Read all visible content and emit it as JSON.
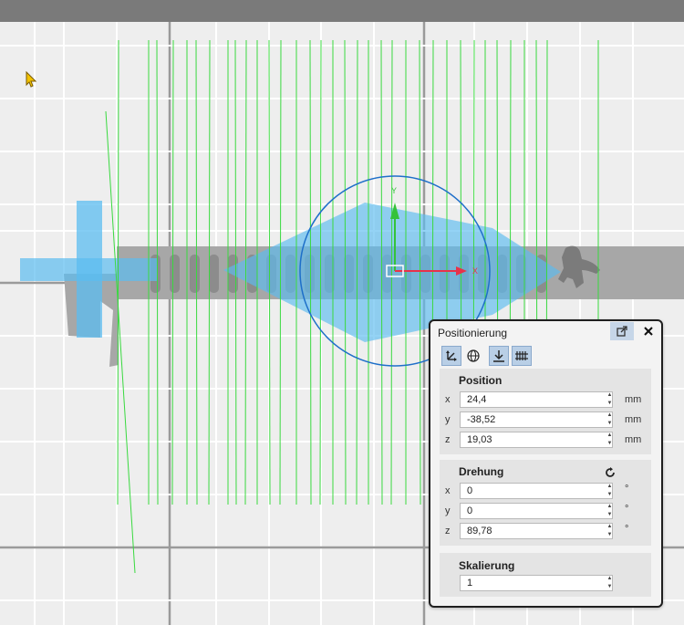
{
  "panel": {
    "title": "Positionierung",
    "position": {
      "title": "Position",
      "rows": [
        {
          "axis": "x",
          "value": "24,4",
          "unit": "mm"
        },
        {
          "axis": "y",
          "value": "-38,52",
          "unit": "mm"
        },
        {
          "axis": "z",
          "value": "19,03",
          "unit": "mm"
        }
      ]
    },
    "rotation": {
      "title": "Drehung",
      "rows": [
        {
          "axis": "x",
          "value": "0",
          "unit": "°"
        },
        {
          "axis": "y",
          "value": "0",
          "unit": "°"
        },
        {
          "axis": "z",
          "value": "89,78",
          "unit": "°"
        }
      ]
    },
    "scale": {
      "title": "Skalierung",
      "value": "1"
    }
  },
  "gizmo": {
    "y_label": "Y",
    "x_label": "X"
  },
  "colors": {
    "accent": "#1e6fc9",
    "toolpath": "#39d93f",
    "model": "#a7a7a7",
    "gizmo_fill": "#5bbcf0",
    "x_axis": "#e8324a",
    "y_axis": "#35c23a"
  },
  "icons": [
    "popout-icon",
    "close-icon",
    "move-icon",
    "globe-icon",
    "drop-to-bed-icon",
    "grid-icon",
    "reset-rotation-icon",
    "cursor-icon"
  ]
}
